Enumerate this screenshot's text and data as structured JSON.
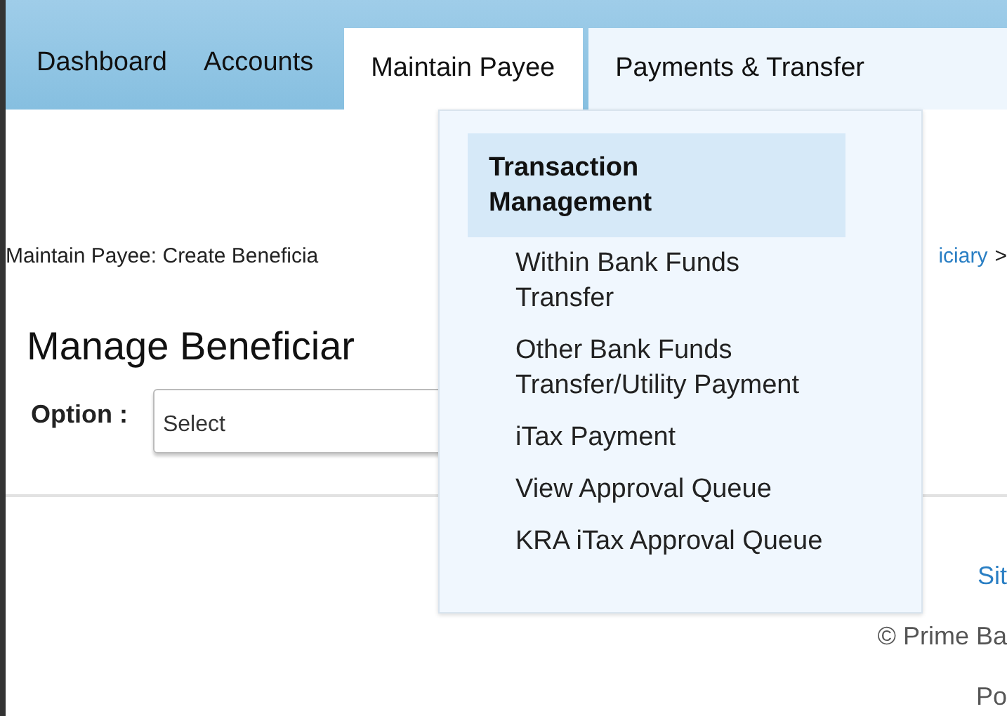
{
  "nav": {
    "tabs": [
      {
        "label": "Dashboard",
        "selected": false,
        "open": false
      },
      {
        "label": "Accounts",
        "selected": false,
        "open": false
      },
      {
        "label": "Maintain Payee",
        "selected": true,
        "open": false
      },
      {
        "label": "Payments & Transfer",
        "selected": false,
        "open": true
      }
    ]
  },
  "menu": {
    "heading": "Transaction Management",
    "items": [
      "Within Bank Funds Transfer",
      "Other Bank Funds Transfer/Utility Payment",
      "iTax Payment",
      "View Approval Queue",
      "KRA iTax Approval Queue"
    ]
  },
  "breadcrumb": {
    "text": "Maintain Payee: Create Beneficia",
    "link": "iciary",
    "separator": ">"
  },
  "heading": "Manage Beneficiar",
  "option": {
    "label": "Option :",
    "value": "Select"
  },
  "footer": {
    "link": "Sit",
    "copyright": "© Prime Ba",
    "powered": "Po"
  }
}
